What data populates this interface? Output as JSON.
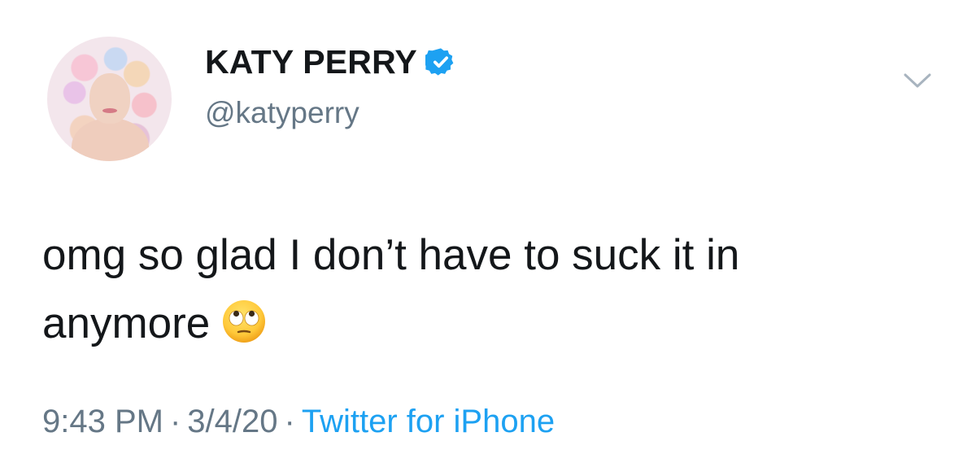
{
  "author": {
    "display_name": "KATY PERRY",
    "handle": "@katyperry",
    "verified": true,
    "verified_icon": "verified-badge-icon",
    "verified_color": "#1da1f2"
  },
  "tweet": {
    "text_line_1": "omg so glad I don’t have to suck it in",
    "text_line_2": "anymore",
    "emoji": "face-with-rolling-eyes-emoji"
  },
  "meta": {
    "time": "9:43 PM",
    "separator": "·",
    "date": "3/4/20",
    "source": "Twitter for iPhone",
    "source_color": "#1da1f2",
    "meta_color": "#657786"
  },
  "controls": {
    "more_menu_icon": "chevron-down-icon"
  }
}
